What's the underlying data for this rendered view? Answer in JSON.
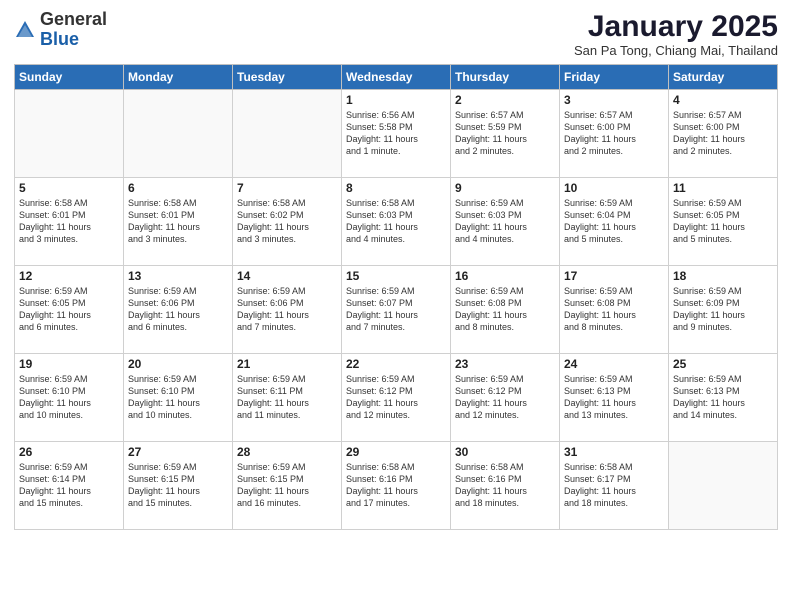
{
  "header": {
    "logo_general": "General",
    "logo_blue": "Blue",
    "month_title": "January 2025",
    "subtitle": "San Pa Tong, Chiang Mai, Thailand"
  },
  "weekdays": [
    "Sunday",
    "Monday",
    "Tuesday",
    "Wednesday",
    "Thursday",
    "Friday",
    "Saturday"
  ],
  "weeks": [
    [
      {
        "day": "",
        "info": ""
      },
      {
        "day": "",
        "info": ""
      },
      {
        "day": "",
        "info": ""
      },
      {
        "day": "1",
        "info": "Sunrise: 6:56 AM\nSunset: 5:58 PM\nDaylight: 11 hours\nand 1 minute."
      },
      {
        "day": "2",
        "info": "Sunrise: 6:57 AM\nSunset: 5:59 PM\nDaylight: 11 hours\nand 2 minutes."
      },
      {
        "day": "3",
        "info": "Sunrise: 6:57 AM\nSunset: 6:00 PM\nDaylight: 11 hours\nand 2 minutes."
      },
      {
        "day": "4",
        "info": "Sunrise: 6:57 AM\nSunset: 6:00 PM\nDaylight: 11 hours\nand 2 minutes."
      }
    ],
    [
      {
        "day": "5",
        "info": "Sunrise: 6:58 AM\nSunset: 6:01 PM\nDaylight: 11 hours\nand 3 minutes."
      },
      {
        "day": "6",
        "info": "Sunrise: 6:58 AM\nSunset: 6:01 PM\nDaylight: 11 hours\nand 3 minutes."
      },
      {
        "day": "7",
        "info": "Sunrise: 6:58 AM\nSunset: 6:02 PM\nDaylight: 11 hours\nand 3 minutes."
      },
      {
        "day": "8",
        "info": "Sunrise: 6:58 AM\nSunset: 6:03 PM\nDaylight: 11 hours\nand 4 minutes."
      },
      {
        "day": "9",
        "info": "Sunrise: 6:59 AM\nSunset: 6:03 PM\nDaylight: 11 hours\nand 4 minutes."
      },
      {
        "day": "10",
        "info": "Sunrise: 6:59 AM\nSunset: 6:04 PM\nDaylight: 11 hours\nand 5 minutes."
      },
      {
        "day": "11",
        "info": "Sunrise: 6:59 AM\nSunset: 6:05 PM\nDaylight: 11 hours\nand 5 minutes."
      }
    ],
    [
      {
        "day": "12",
        "info": "Sunrise: 6:59 AM\nSunset: 6:05 PM\nDaylight: 11 hours\nand 6 minutes."
      },
      {
        "day": "13",
        "info": "Sunrise: 6:59 AM\nSunset: 6:06 PM\nDaylight: 11 hours\nand 6 minutes."
      },
      {
        "day": "14",
        "info": "Sunrise: 6:59 AM\nSunset: 6:06 PM\nDaylight: 11 hours\nand 7 minutes."
      },
      {
        "day": "15",
        "info": "Sunrise: 6:59 AM\nSunset: 6:07 PM\nDaylight: 11 hours\nand 7 minutes."
      },
      {
        "day": "16",
        "info": "Sunrise: 6:59 AM\nSunset: 6:08 PM\nDaylight: 11 hours\nand 8 minutes."
      },
      {
        "day": "17",
        "info": "Sunrise: 6:59 AM\nSunset: 6:08 PM\nDaylight: 11 hours\nand 8 minutes."
      },
      {
        "day": "18",
        "info": "Sunrise: 6:59 AM\nSunset: 6:09 PM\nDaylight: 11 hours\nand 9 minutes."
      }
    ],
    [
      {
        "day": "19",
        "info": "Sunrise: 6:59 AM\nSunset: 6:10 PM\nDaylight: 11 hours\nand 10 minutes."
      },
      {
        "day": "20",
        "info": "Sunrise: 6:59 AM\nSunset: 6:10 PM\nDaylight: 11 hours\nand 10 minutes."
      },
      {
        "day": "21",
        "info": "Sunrise: 6:59 AM\nSunset: 6:11 PM\nDaylight: 11 hours\nand 11 minutes."
      },
      {
        "day": "22",
        "info": "Sunrise: 6:59 AM\nSunset: 6:12 PM\nDaylight: 11 hours\nand 12 minutes."
      },
      {
        "day": "23",
        "info": "Sunrise: 6:59 AM\nSunset: 6:12 PM\nDaylight: 11 hours\nand 12 minutes."
      },
      {
        "day": "24",
        "info": "Sunrise: 6:59 AM\nSunset: 6:13 PM\nDaylight: 11 hours\nand 13 minutes."
      },
      {
        "day": "25",
        "info": "Sunrise: 6:59 AM\nSunset: 6:13 PM\nDaylight: 11 hours\nand 14 minutes."
      }
    ],
    [
      {
        "day": "26",
        "info": "Sunrise: 6:59 AM\nSunset: 6:14 PM\nDaylight: 11 hours\nand 15 minutes."
      },
      {
        "day": "27",
        "info": "Sunrise: 6:59 AM\nSunset: 6:15 PM\nDaylight: 11 hours\nand 15 minutes."
      },
      {
        "day": "28",
        "info": "Sunrise: 6:59 AM\nSunset: 6:15 PM\nDaylight: 11 hours\nand 16 minutes."
      },
      {
        "day": "29",
        "info": "Sunrise: 6:58 AM\nSunset: 6:16 PM\nDaylight: 11 hours\nand 17 minutes."
      },
      {
        "day": "30",
        "info": "Sunrise: 6:58 AM\nSunset: 6:16 PM\nDaylight: 11 hours\nand 18 minutes."
      },
      {
        "day": "31",
        "info": "Sunrise: 6:58 AM\nSunset: 6:17 PM\nDaylight: 11 hours\nand 18 minutes."
      },
      {
        "day": "",
        "info": ""
      }
    ]
  ]
}
